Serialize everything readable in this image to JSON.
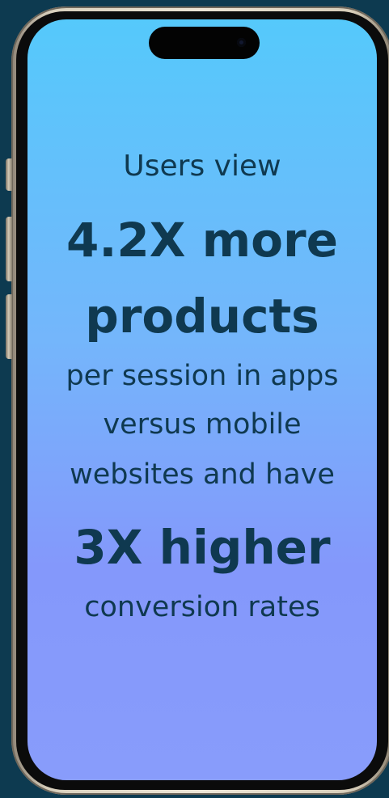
{
  "phone": {
    "lines": [
      "Users view",
      "4.2X more",
      "products",
      "per session in apps",
      "versus mobile",
      "websites and have",
      "3X higher",
      "conversion rates"
    ]
  },
  "colors": {
    "background": "#0d3a50",
    "screen_gradient_start": "#55c9fb",
    "screen_gradient_end": "#889cfb",
    "text": "#0f3950"
  }
}
